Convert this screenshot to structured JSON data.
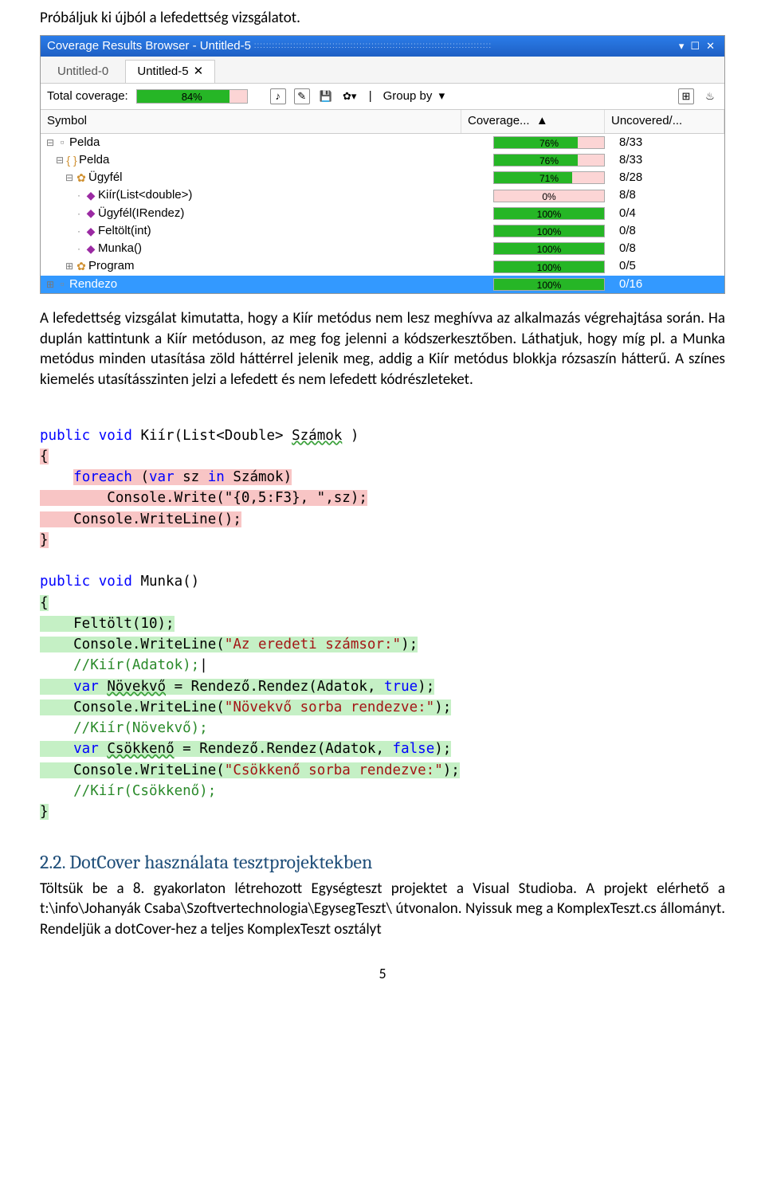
{
  "intro": "Próbáljuk ki újból a lefedettség vizsgálatot.",
  "cov_window": {
    "title": "Coverage Results Browser - Untitled-5",
    "tabs": [
      {
        "label": "Untitled-0",
        "active": false
      },
      {
        "label": "Untitled-5",
        "active": true
      }
    ],
    "total_label": "Total coverage:",
    "total_pct": "84%",
    "group_by": "Group by",
    "headers": {
      "symbol": "Symbol",
      "coverage": "Coverage...",
      "uncovered": "Uncovered/..."
    },
    "rows": [
      {
        "indent": 0,
        "toggle": "-",
        "icon": "▫",
        "icolor": "#888",
        "label": "Pelda",
        "pct": "76%",
        "pctw": 76,
        "unc": "8/33",
        "sel": false
      },
      {
        "indent": 1,
        "toggle": "-",
        "icon": "{ }",
        "icolor": "#d09030",
        "label": "Pelda",
        "pct": "76%",
        "pctw": 76,
        "unc": "8/33",
        "sel": false
      },
      {
        "indent": 2,
        "toggle": "-",
        "icon": "✿",
        "icolor": "#d09030",
        "label": "Ügyfél",
        "pct": "71%",
        "pctw": 71,
        "unc": "8/28",
        "sel": false
      },
      {
        "indent": 3,
        "toggle": "",
        "icon": "◆",
        "icolor": "#9b2aa3",
        "label": "Kiír(List<double>)",
        "pct": "0%",
        "pctw": 0,
        "unc": "8/8",
        "sel": false
      },
      {
        "indent": 3,
        "toggle": "",
        "icon": "◆",
        "icolor": "#9b2aa3",
        "label": "Ügyfél(IRendez)",
        "pct": "100%",
        "pctw": 100,
        "unc": "0/4",
        "sel": false
      },
      {
        "indent": 3,
        "toggle": "",
        "icon": "◆",
        "icolor": "#9b2aa3",
        "label": "Feltölt(int)",
        "pct": "100%",
        "pctw": 100,
        "unc": "0/8",
        "sel": false
      },
      {
        "indent": 3,
        "toggle": "",
        "icon": "◆",
        "icolor": "#9b2aa3",
        "label": "Munka()",
        "pct": "100%",
        "pctw": 100,
        "unc": "0/8",
        "sel": false
      },
      {
        "indent": 2,
        "toggle": "+",
        "icon": "✿",
        "icolor": "#d09030",
        "label": "Program",
        "pct": "100%",
        "pctw": 100,
        "unc": "0/5",
        "sel": false
      },
      {
        "indent": 0,
        "toggle": "+",
        "icon": "▫",
        "icolor": "#888",
        "label": "Rendezo",
        "pct": "100%",
        "pctw": 100,
        "unc": "0/16",
        "sel": true
      }
    ]
  },
  "para1": "A lefedettség vizsgálat kimutatta, hogy a Kiír metódus nem lesz meghívva az alkalmazás végrehajtása során. Ha duplán kattintunk a Kiír metóduson, az meg fog jelenni a kódszerkesztőben. Láthatjuk, hogy míg pl. a Munka metódus minden utasítása zöld háttérrel jelenik meg, addig a Kiír metódus blokkja rózsaszín hátterű. A színes kiemelés utasításszinten jelzi a lefedett és nem lefedett kódrészleteket.",
  "code": {
    "l1a": "public",
    "l1b": " void",
    "l1c": " Kiír(List<Double> ",
    "l1d": "Számok",
    "l1e": " )",
    "l3a": "foreach",
    "l3b": " (",
    "l3c": "var",
    "l3d": " sz ",
    "l3e": "in",
    "l3f": " Számok)",
    "l4": "        Console.Write(\"{0,5:F3}, \",sz);",
    "l5": "    Console.WriteLine();",
    "l7a": "public",
    "l7b": " void",
    "l7c": " Munka()",
    "l9": "    Feltölt(10);",
    "l10a": "    Console.WriteLine(",
    "l10b": "\"Az eredeti számsor:\"",
    "l10c": ");",
    "l11": "    //Kiír(Adatok);",
    "l12a": "    var",
    "l12b": " ",
    "l12c": "Növekvő",
    "l12d": " = Rendező.Rendez(Adatok, ",
    "l12e": "true",
    "l12f": ");",
    "l13a": "    Console.WriteLine(",
    "l13b": "\"Növekvő sorba rendezve:\"",
    "l13c": ");",
    "l14": "    //Kiír(Növekvő);",
    "l15a": "    var",
    "l15b": " ",
    "l15c": "Csökkenő",
    "l15d": " = Rendező.Rendez(Adatok, ",
    "l15e": "false",
    "l15f": ");",
    "l16a": "    Console.WriteLine(",
    "l16b": "\"Csökkenő sorba rendezve:\"",
    "l16c": ");",
    "l17": "    //Kiír(Csökkenő);"
  },
  "section_title": "2.2. DotCover használata tesztprojektekben",
  "para2": "Töltsük be a 8. gyakorlaton létrehozott Egységteszt projektet a Visual Studioba. A projekt elérhető a t:\\info\\Johanyák Csaba\\Szoftvertechnologia\\EgysegTeszt\\ útvonalon. Nyissuk meg a KomplexTeszt.cs állományt. Rendeljük a dotCover-hez a teljes KomplexTeszt osztályt",
  "page_num": "5",
  "chart_data": {
    "type": "bar",
    "title": "Coverage Results Browser - Untitled-5",
    "total_coverage_pct": 84,
    "columns": [
      "Symbol",
      "Coverage",
      "Uncovered"
    ],
    "series": [
      {
        "symbol": "Pelda",
        "coverage_pct": 76,
        "uncovered": "8/33"
      },
      {
        "symbol": "Pelda.Pelda",
        "coverage_pct": 76,
        "uncovered": "8/33"
      },
      {
        "symbol": "Pelda.Pelda.Ügyfél",
        "coverage_pct": 71,
        "uncovered": "8/28"
      },
      {
        "symbol": "Pelda.Pelda.Ügyfél.Kiír(List<double>)",
        "coverage_pct": 0,
        "uncovered": "8/8"
      },
      {
        "symbol": "Pelda.Pelda.Ügyfél.Ügyfél(IRendez)",
        "coverage_pct": 100,
        "uncovered": "0/4"
      },
      {
        "symbol": "Pelda.Pelda.Ügyfél.Feltölt(int)",
        "coverage_pct": 100,
        "uncovered": "0/8"
      },
      {
        "symbol": "Pelda.Pelda.Ügyfél.Munka()",
        "coverage_pct": 100,
        "uncovered": "0/8"
      },
      {
        "symbol": "Pelda.Pelda.Program",
        "coverage_pct": 100,
        "uncovered": "0/5"
      },
      {
        "symbol": "Rendezo",
        "coverage_pct": 100,
        "uncovered": "0/16"
      }
    ]
  }
}
